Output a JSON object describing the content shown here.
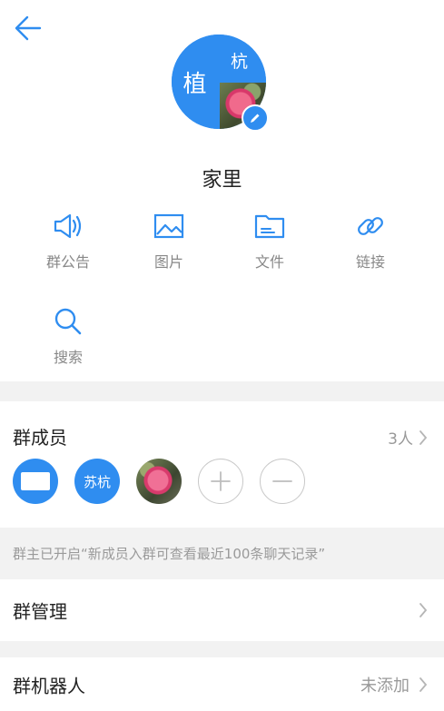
{
  "header": {
    "back_icon": "back-arrow-icon"
  },
  "group": {
    "avatar_left_text": "植",
    "avatar_topright_text": "杭",
    "name": "家里"
  },
  "tools": [
    {
      "label": "群公告",
      "icon": "megaphone-icon"
    },
    {
      "label": "图片",
      "icon": "image-icon"
    },
    {
      "label": "文件",
      "icon": "folder-icon"
    },
    {
      "label": "链接",
      "icon": "link-icon"
    },
    {
      "label": "搜索",
      "icon": "search-icon"
    }
  ],
  "members": {
    "title": "群成员",
    "count": "3人",
    "member2_text": "苏杭"
  },
  "notice": "群主已开启“新成员入群可查看最近100条聊天记录”",
  "settings": {
    "manage_label": "群管理",
    "robot_label": "群机器人",
    "robot_value": "未添加"
  },
  "colors": {
    "accent": "#2f8df0",
    "divider": "#f2f2f2",
    "muted": "#999999"
  }
}
